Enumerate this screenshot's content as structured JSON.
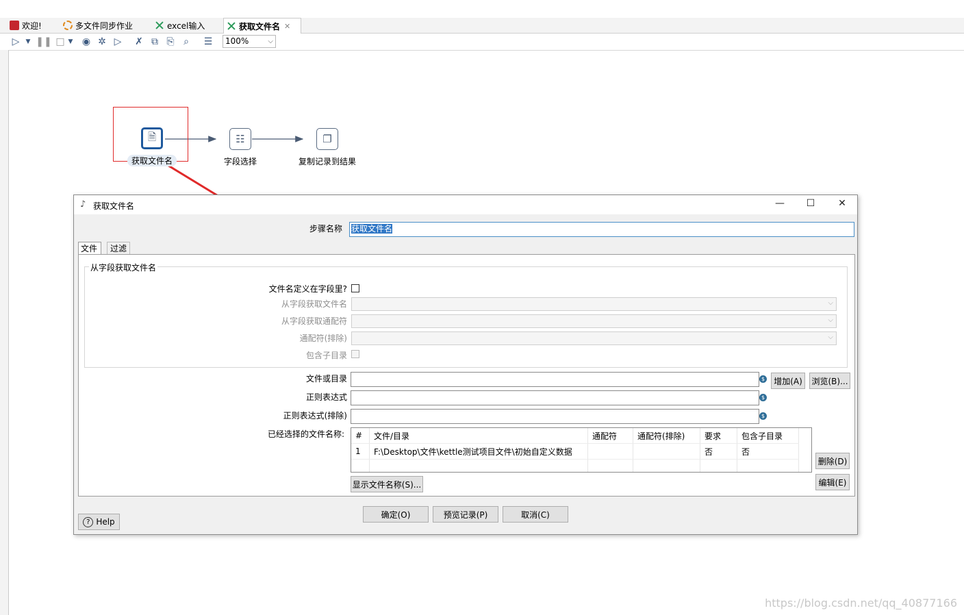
{
  "tabs": [
    {
      "label": "欢迎!",
      "icon": "kettle-welcome-icon"
    },
    {
      "label": "多文件同步作业",
      "icon": "job-icon"
    },
    {
      "label": "excel输入",
      "icon": "transformation-icon"
    },
    {
      "label": "获取文件名",
      "icon": "transformation-icon",
      "active": true
    }
  ],
  "toolbar": {
    "zoom": "100%"
  },
  "canvas": {
    "nodes": [
      {
        "label": "获取文件名"
      },
      {
        "label": "字段选择"
      },
      {
        "label": "复制记录到结果"
      }
    ]
  },
  "dialog": {
    "title": "获取文件名",
    "step_name_label": "步骤名称",
    "step_name_value": "获取文件名",
    "tabs": [
      "文件",
      "过滤"
    ],
    "group_title": "从字段获取文件名",
    "filename_in_field_label": "文件名定义在字段里?",
    "field_filename_label": "从字段获取文件名",
    "field_wildcard_label": "从字段获取通配符",
    "wildcard_exclude_label": "通配符(排除)",
    "include_subdir_label": "包含子目录",
    "file_or_dir_label": "文件或目录",
    "regex_label": "正则表达式",
    "regex_exclude_label": "正则表达式(排除)",
    "selected_files_label": "已经选择的文件名称:",
    "add_button": "增加(A)",
    "browse_button": "浏览(B)...",
    "delete_button": "删除(D)",
    "edit_button": "编辑(E)",
    "show_files_button": "显示文件名称(S)...",
    "table": {
      "headers": [
        "#",
        "文件/目录",
        "通配符",
        "通配符(排除)",
        "要求",
        "包含子目录"
      ],
      "rows": [
        [
          "1",
          "F:\\Desktop\\文件\\kettle测试项目文件\\初始自定义数据",
          "",
          "",
          "否",
          "否"
        ]
      ]
    },
    "ok_button": "确定(O)",
    "preview_button": "预览记录(P)",
    "cancel_button": "取消(C)",
    "help_button": "Help"
  },
  "watermark": "https://blog.csdn.net/qq_40877166",
  "colors": {
    "accent": "#1f5a9e",
    "selection_box": "#e02a2a",
    "arrow": "#e02a2a"
  }
}
